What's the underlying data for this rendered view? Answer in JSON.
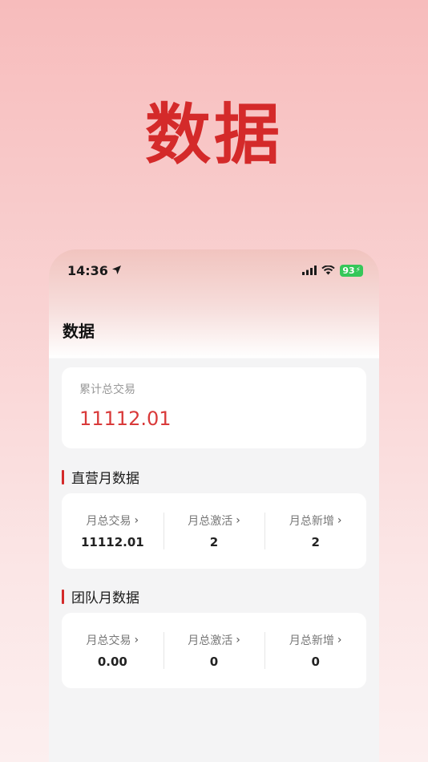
{
  "hero": {
    "title": "数据"
  },
  "status_bar": {
    "time": "14:36",
    "battery": "93"
  },
  "page": {
    "title": "数据"
  },
  "total": {
    "label": "累计总交易",
    "value": "11112.01"
  },
  "direct": {
    "title": "直营月数据",
    "stats": [
      {
        "label": "月总交易",
        "value": "11112.01"
      },
      {
        "label": "月总激活",
        "value": "2"
      },
      {
        "label": "月总新增",
        "value": "2"
      }
    ]
  },
  "team": {
    "title": "团队月数据",
    "stats": [
      {
        "label": "月总交易",
        "value": "0.00"
      },
      {
        "label": "月总激活",
        "value": "0"
      },
      {
        "label": "月总新增",
        "value": "0"
      }
    ]
  },
  "icons": {
    "chevron": "›",
    "location": "location-arrow-icon",
    "signal": "cellular-signal-icon",
    "wifi": "wifi-icon",
    "battery": "battery-icon"
  },
  "colors": {
    "accent": "#d42a2a",
    "value_red": "#d93a3a",
    "battery_green": "#35c759"
  }
}
